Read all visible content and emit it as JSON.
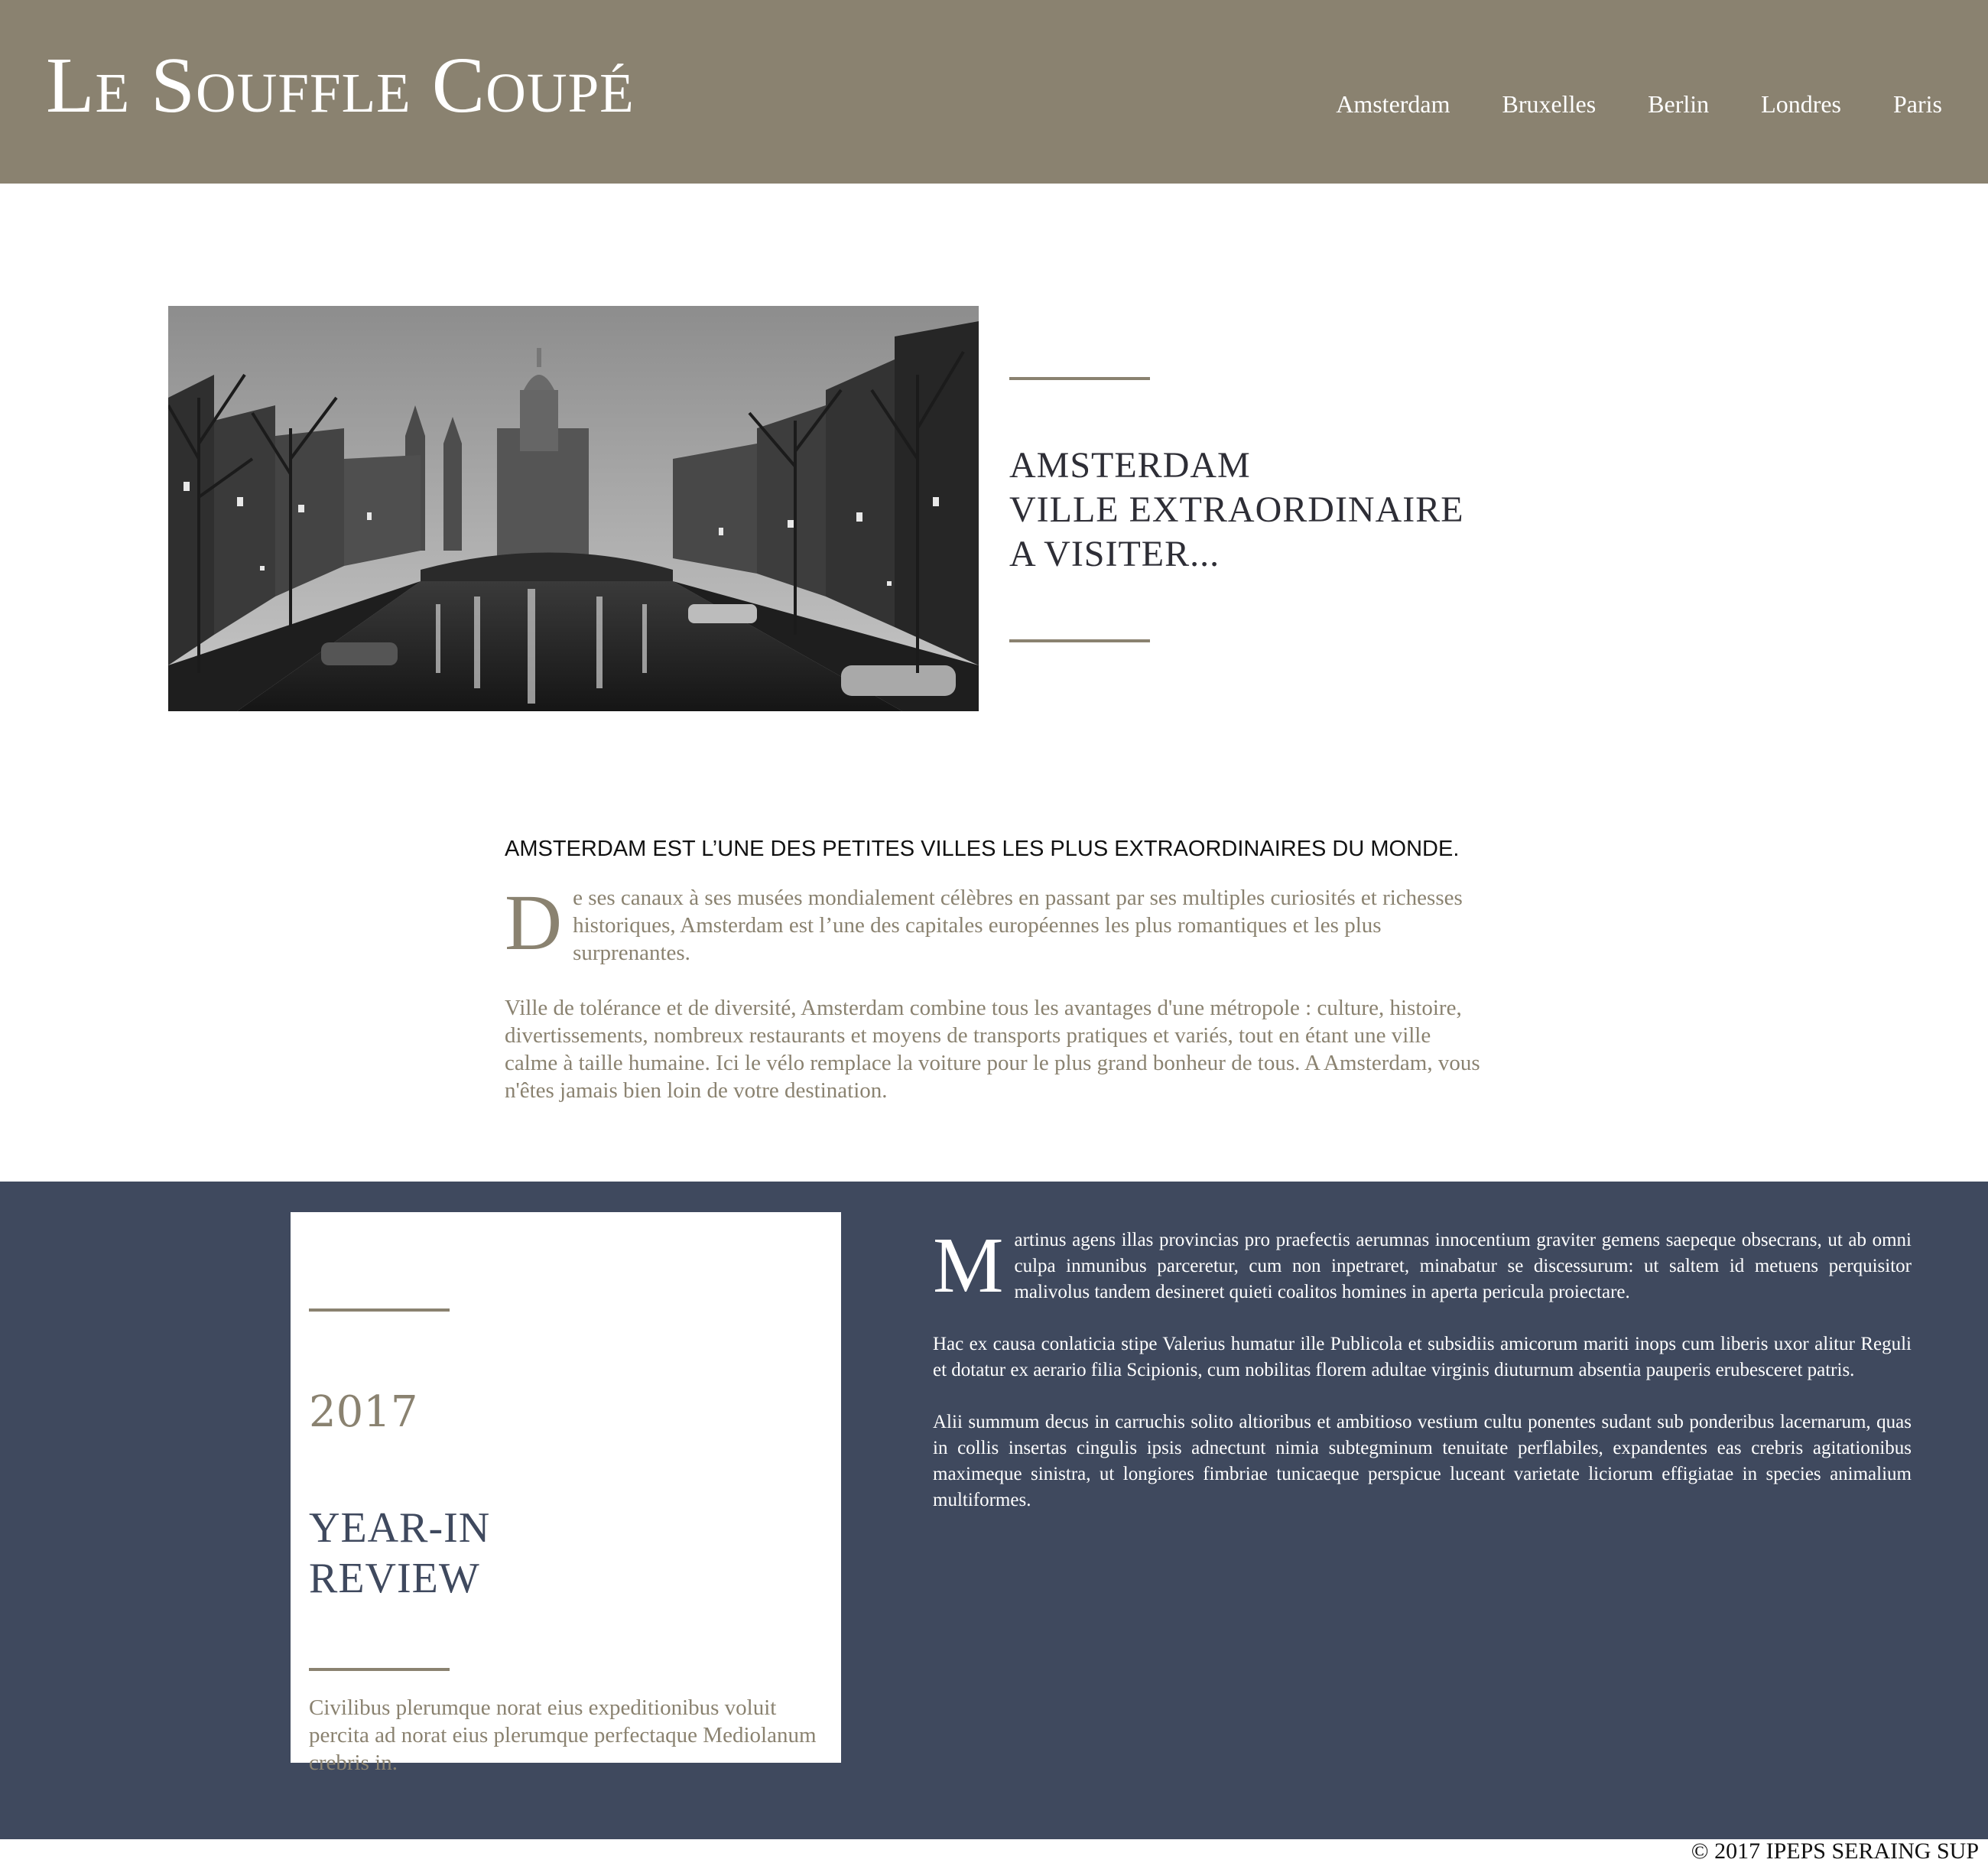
{
  "header": {
    "logo": "Le Souffle Coupé",
    "nav": [
      "Amsterdam",
      "Bruxelles",
      "Berlin",
      "Londres",
      "Paris"
    ]
  },
  "hero": {
    "image_alt": "photo-amsterdam-canal",
    "title_lines": [
      "AMSTERDAM",
      "VILLE EXTRAORDINAIRE",
      "A VISITER..."
    ]
  },
  "article": {
    "heading": "AMSTERDAM EST L’UNE DES PETITES VILLES LES PLUS EXTRAORDINAIRES DU MONDE.",
    "p1_dropcap": "D",
    "p1_rest": "e ses canaux à ses musées mondialement célèbres en passant par ses multiples curiosités et richesses historiques, Amsterdam est l’une des capitales européennes les plus romantiques et les plus surprenantes.",
    "p2": "Ville de tolérance et de diversité, Amsterdam combine tous les avantages d'une métropole : culture, histoire, divertissements, nombreux restaurants et moyens de transports pratiques et variés, tout en étant une ville calme à taille humaine. Ici le vélo remplace la voiture pour le plus grand bonheur de tous. A Amsterdam, vous n'êtes jamais bien loin de votre destination."
  },
  "review_card": {
    "year": "2017",
    "title_lines": [
      "YEAR-IN",
      "REVIEW"
    ],
    "caption": "Civilibus plerumque norat eius expeditionibus voluit percita ad norat eius plerumque perfectaque Mediolanum crebris in."
  },
  "band_text": {
    "p1_dropcap": "M",
    "p1_rest": "artinus agens illas provincias pro praefectis aerumnas innocentium graviter gemens saepeque obsecrans, ut ab omni culpa inmunibus parceretur, cum non inpetraret, minabatur se discessurum: ut saltem id metuens perquisitor malivolus tandem desineret quieti coalitos homines in aperta pericula proiectare.",
    "p2": "Hac ex causa conlaticia stipe Valerius humatur ille Publicola et subsidiis amicorum mariti inops cum liberis uxor alitur Reguli et dotatur ex aerario filia Scipionis, cum nobilitas florem adultae virginis diuturnum absentia pauperis erubesceret patris.",
    "p3": "Alii summum decus in carruchis solito altioribus et ambitioso vestium cultu ponentes sudant sub ponderibus lacernarum, quas in collis insertas cingulis ipsis adnectunt nimia subtegminum tenuitate perflabiles, expandentes eas crebris agitationibus maximeque sinistra, ut longiores fimbriae tunicaeque perspicue luceant varietate liciorum effigiatae in species animalium multiformes."
  },
  "footer": {
    "copyright": "© 2017 IPEPS SERAING SUP"
  },
  "colors": {
    "taupe": "#8a8270",
    "navy": "#3f495e",
    "white": "#ffffff"
  }
}
